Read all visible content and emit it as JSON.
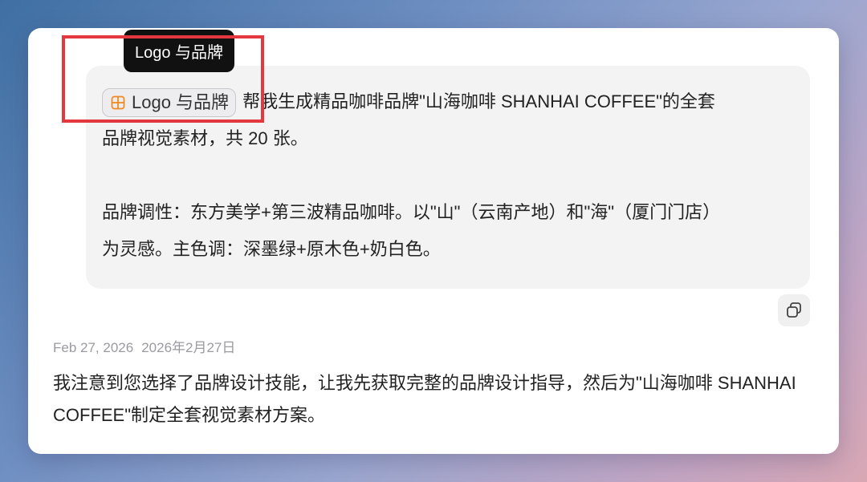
{
  "tooltip": {
    "text": "Logo 与品牌"
  },
  "user_message": {
    "skill_chip": {
      "label": "Logo 与品牌",
      "icon": "layout-grid-icon",
      "icon_color": "#f08a24"
    },
    "line1": "帮我生成精品咖啡品牌\"山海咖啡 SHANHAI COFFEE\"的全套",
    "line2": "品牌视觉素材，共 20 张。",
    "line3": "品牌调性：东方美学+第三波精品咖啡。以\"山\"（云南产地）和\"海\"（厦门门店）",
    "line4": "为灵感。主色调：深墨绿+原木色+奶白色。"
  },
  "copy_button": {
    "icon": "copy-icon"
  },
  "timestamp": {
    "english": "Feb 27, 2026",
    "chinese": "2026年2月27日"
  },
  "assistant_message": {
    "text": "我注意到您选择了品牌设计技能，让我先获取完整的品牌设计指导，然后为\"山海咖啡 SHANHAI COFFEE\"制定全套视觉素材方案。"
  },
  "colors": {
    "highlight": "#e3383f",
    "tooltip_bg": "#111111",
    "bubble_bg": "#f3f3f4"
  }
}
